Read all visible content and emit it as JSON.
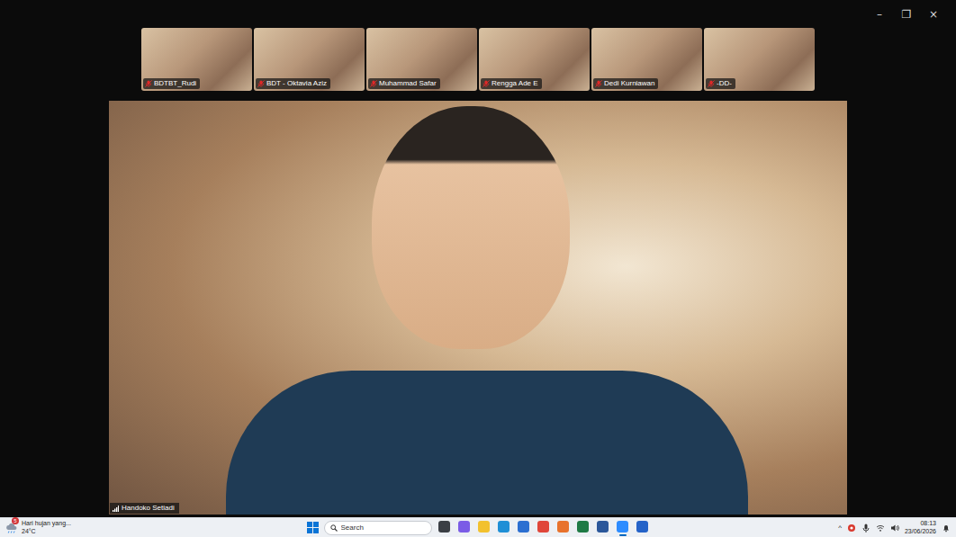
{
  "window": {
    "controls": [
      "–",
      "❐",
      "×"
    ]
  },
  "gallery": [
    {
      "name": "BDTBT_Rudi",
      "muted": true
    },
    {
      "name": "BDT - Oktavia Aziz",
      "muted": true
    },
    {
      "name": "Muhammad Safar",
      "muted": true
    },
    {
      "name": "Rengga Ade E",
      "muted": true
    },
    {
      "name": "Dedi Kurniawan",
      "muted": true
    },
    {
      "name": "-DD-",
      "muted": true
    }
  ],
  "speaker": {
    "name": "Handoko Setiadi",
    "muted": false
  },
  "taskbar": {
    "weather": {
      "text": "Hari hujan yang...",
      "temp": "24°C",
      "badge": "5"
    },
    "search": {
      "placeholder": "Search"
    },
    "apps": [
      {
        "color": "#3b3f45",
        "selected": false
      },
      {
        "color": "#7b5ce6",
        "selected": false
      },
      {
        "color": "#f2c12e",
        "selected": false
      },
      {
        "color": "#1f8fd6",
        "selected": false
      },
      {
        "color": "#2b6fd1",
        "selected": false
      },
      {
        "color": "#e0463a",
        "selected": false
      },
      {
        "color": "#e8722c",
        "selected": false
      },
      {
        "color": "#1f7a45",
        "selected": false
      },
      {
        "color": "#2b579a",
        "selected": false
      },
      {
        "color": "#2d8cff",
        "selected": true
      },
      {
        "color": "#2563c8",
        "selected": false
      }
    ],
    "tray": {
      "chevron": "^",
      "time": "08:13",
      "date": "23/06/2026"
    }
  }
}
